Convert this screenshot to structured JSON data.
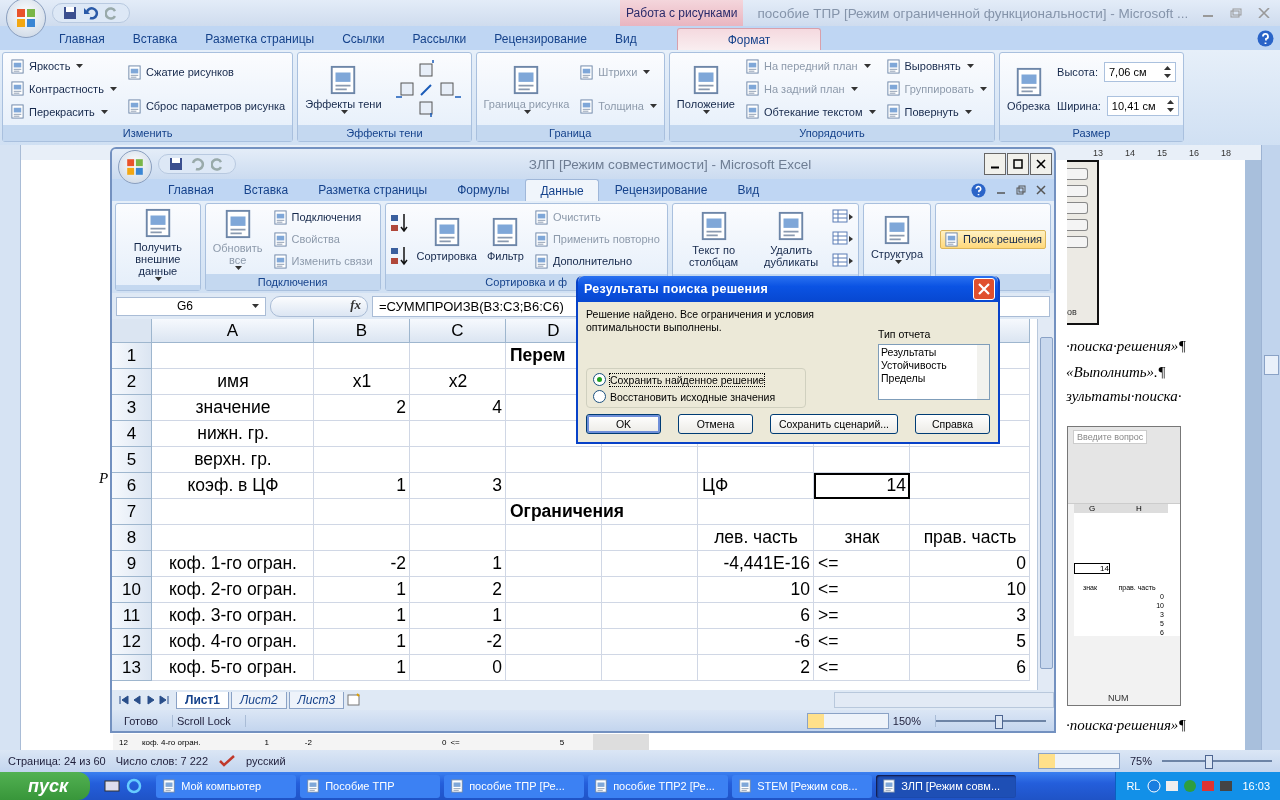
{
  "word": {
    "context_tab": "Работа с рисунками",
    "title": "пособие ТПР [Режим ограниченной функциональности] - Microsoft ...",
    "tabs": [
      {
        "label": "Главная",
        "selected": false
      },
      {
        "label": "Вставка",
        "selected": false
      },
      {
        "label": "Разметка страницы",
        "selected": false
      },
      {
        "label": "Ссылки",
        "selected": false
      },
      {
        "label": "Рассылки",
        "selected": false
      },
      {
        "label": "Рецензирование",
        "selected": false
      },
      {
        "label": "Вид",
        "selected": false
      },
      {
        "label": "Формат",
        "selected": true
      }
    ],
    "ribbon": [
      {
        "label": "Изменить",
        "columns": [
          [
            {
              "kind": "small",
              "label": "Яркость",
              "menu": true,
              "disabled": false
            },
            {
              "kind": "small",
              "label": "Контрастность",
              "menu": true,
              "disabled": false
            },
            {
              "kind": "small",
              "label": "Перекрасить",
              "menu": true,
              "disabled": false
            }
          ],
          [
            {
              "kind": "small",
              "label": "Сжатие рисунков",
              "menu": false,
              "disabled": false
            },
            {
              "kind": "small",
              "label": "Сброс параметров рисунка",
              "menu": false,
              "disabled": false
            }
          ]
        ]
      },
      {
        "label": "Эффекты тени",
        "columns": [
          [
            {
              "kind": "large",
              "label": "Эффекты тени",
              "menu": true,
              "disabled": false
            }
          ],
          [
            {
              "kind": "nudge"
            }
          ]
        ]
      },
      {
        "label": "Граница",
        "columns": [
          [
            {
              "kind": "large",
              "label": "Граница рисунка",
              "menu": true,
              "disabled": true
            }
          ],
          [
            {
              "kind": "small",
              "label": "Штрихи",
              "menu": true,
              "disabled": true
            },
            {
              "kind": "small",
              "label": "Толщина",
              "menu": true,
              "disabled": true
            }
          ]
        ]
      },
      {
        "label": "Упорядочить",
        "columns": [
          [
            {
              "kind": "large",
              "label": "Положение",
              "menu": true,
              "disabled": false
            }
          ],
          [
            {
              "kind": "small",
              "label": "На передний план",
              "menu": true,
              "disabled": true
            },
            {
              "kind": "small",
              "label": "На задний план",
              "menu": true,
              "disabled": true
            },
            {
              "kind": "small",
              "label": "Обтекание текстом",
              "menu": true,
              "disabled": false
            }
          ],
          [
            {
              "kind": "small",
              "label": "Выровнять",
              "menu": true,
              "disabled": false
            },
            {
              "kind": "small",
              "label": "Группировать",
              "menu": true,
              "disabled": true
            },
            {
              "kind": "small",
              "label": "Повернуть",
              "menu": true,
              "disabled": false
            }
          ]
        ]
      },
      {
        "label": "Размер",
        "columns": [
          [
            {
              "kind": "large",
              "label": "Обрезка",
              "menu": false,
              "disabled": false
            }
          ],
          [
            {
              "kind": "field",
              "label": "Высота:",
              "value": "7,06 см"
            },
            {
              "kind": "field",
              "label": "Ширина:",
              "value": "10,41 см"
            }
          ]
        ]
      }
    ],
    "ruler": [
      "13",
      "14",
      "15",
      "16",
      "18"
    ],
    "document": {
      "fragments": [
        {
          "text": "·поиска·решения»¶",
          "kind": "italic"
        },
        {
          "text": "«Выполнить».¶",
          "kind": "italic"
        },
        {
          "text": "зультаты·поиска·",
          "kind": "italic"
        },
        {
          "text": "·поиска·решения»¶",
          "kind": "italic"
        },
        {
          "text": "Р",
          "kind": "italic"
        }
      ],
      "top_image_text": "ов",
      "image_row": [
        "12",
        "коф. 4-го огран.",
        "1",
        "-2",
        "0",
        "<=",
        "5"
      ],
      "screenshot": {
        "question": "Введите вопрос",
        "columns": [
          "G",
          "H"
        ],
        "value": "14",
        "headers": [
          "знак",
          "прав. часть"
        ],
        "values": [
          "0",
          "10",
          "3",
          "5",
          "6"
        ],
        "status": "NUM"
      }
    },
    "status_bar": {
      "page": "Страница: 24 из 60",
      "words": "Число слов: 7 222",
      "language": "русский",
      "zoom": "75%",
      "level": 0.42
    }
  },
  "excel": {
    "title": "ЗЛП  [Режим совместимости] - Microsoft Excel",
    "tabs": [
      {
        "label": "Главная",
        "selected": false
      },
      {
        "label": "Вставка",
        "selected": false
      },
      {
        "label": "Разметка страницы",
        "selected": false
      },
      {
        "label": "Формулы",
        "selected": false
      },
      {
        "label": "Данные",
        "selected": true
      },
      {
        "label": "Рецензирование",
        "selected": false
      },
      {
        "label": "Вид",
        "selected": false
      }
    ],
    "ribbon": [
      {
        "columns": [
          [
            {
              "kind": "large",
              "label": "Получить внешние данные",
              "menu": true,
              "disabled": false
            }
          ]
        ]
      },
      {
        "label": "Подключения",
        "columns": [
          [
            {
              "kind": "large",
              "label": "Обновить все",
              "menu": true,
              "disabled": true
            }
          ],
          [
            {
              "kind": "small",
              "label": "Подключения",
              "menu": false,
              "disabled": false
            },
            {
              "kind": "small",
              "label": "Свойства",
              "menu": false,
              "disabled": true
            },
            {
              "kind": "small",
              "label": "Изменить связи",
              "menu": false,
              "disabled": true
            }
          ]
        ]
      },
      {
        "label": "Сортировка и ф",
        "columns": [
          [
            {
              "kind": "sort"
            },
            {
              "kind": "sort"
            }
          ],
          [
            {
              "kind": "large",
              "label": "Сортировка",
              "menu": false,
              "disabled": false
            }
          ],
          [
            {
              "kind": "large",
              "label": "Фильтр",
              "menu": false,
              "disabled": false
            }
          ],
          [
            {
              "kind": "small",
              "label": "Очистить",
              "menu": false,
              "disabled": true
            },
            {
              "kind": "small",
              "label": "Применить повторно",
              "menu": false,
              "disabled": true
            },
            {
              "kind": "small",
              "label": "Дополнительно",
              "menu": false,
              "disabled": false
            }
          ]
        ]
      },
      {
        "columns": [
          [
            {
              "kind": "large",
              "label": "Текст по столбцам",
              "menu": false,
              "disabled": false
            }
          ],
          [
            {
              "kind": "large",
              "label": "Удалить дубликаты",
              "menu": false,
              "disabled": false
            }
          ],
          [
            {
              "kind": "tool"
            },
            {
              "kind": "tool"
            },
            {
              "kind": "tool"
            }
          ]
        ]
      },
      {
        "columns": [
          [
            {
              "kind": "large",
              "label": "Структура",
              "menu": true,
              "disabled": false
            }
          ]
        ]
      },
      {
        "columns": [
          [
            {
              "kind": "small",
              "label": "Поиск решения",
              "menu": false,
              "disabled": false,
              "highlighted": true
            }
          ]
        ]
      }
    ],
    "name_box": "G6",
    "function_button": "fx",
    "formula": "=СУММПРОИЗВ(B3:C3;B6:C6)",
    "columns": [
      "A",
      "B",
      "C",
      "D"
    ],
    "rows": [
      {
        "number": "1",
        "kind": "section",
        "cells": {
          "d": {
            "text": "Перем",
            "selected": false
          }
        }
      },
      {
        "number": "2",
        "kind": "header",
        "cells": {
          "a": {
            "text": "имя",
            "selected": false
          },
          "b": {
            "text": "x1",
            "selected": false
          },
          "c": {
            "text": "x2",
            "selected": false
          }
        }
      },
      {
        "number": "3",
        "kind": "data",
        "cells": {
          "a": {
            "text": "значение",
            "selected": false
          },
          "b": {
            "text": "2",
            "selected": false
          },
          "c": {
            "text": "4",
            "selected": false
          }
        }
      },
      {
        "number": "4",
        "kind": "data",
        "cells": {
          "a": {
            "text": "нижн. гр.",
            "selected": false
          }
        }
      },
      {
        "number": "5",
        "kind": "data",
        "cells": {
          "a": {
            "text": "верхн. гр.",
            "selected": false
          }
        }
      },
      {
        "number": "6",
        "kind": "data",
        "cells": {
          "a": {
            "text": "коэф. в ЦФ",
            "selected": false
          },
          "b": {
            "text": "1",
            "selected": false
          },
          "c": {
            "text": "3",
            "selected": false
          },
          "f": {
            "text": "ЦФ",
            "selected": false
          },
          "g": {
            "text": "14",
            "selected": true
          }
        }
      },
      {
        "number": "7",
        "kind": "section",
        "cells": {
          "d": {
            "text": "Ограничения",
            "selected": false
          }
        }
      },
      {
        "number": "8",
        "kind": "header",
        "cells": {
          "f": {
            "text": "лев. часть",
            "selected": false
          },
          "g": {
            "text": "знак",
            "selected": false
          },
          "h": {
            "text": "прав. часть",
            "selected": false
          }
        }
      },
      {
        "number": "9",
        "kind": "data",
        "cells": {
          "a": {
            "text": "коф. 1-го огран.",
            "selected": false
          },
          "b": {
            "text": "-2",
            "selected": false
          },
          "c": {
            "text": "1",
            "selected": false
          },
          "f": {
            "text": "-4,441E-16",
            "selected": false
          },
          "g": {
            "text": "<=",
            "selected": false
          },
          "h": {
            "text": "0",
            "selected": false
          }
        }
      },
      {
        "number": "10",
        "kind": "data",
        "cells": {
          "a": {
            "text": "коф. 2-го огран.",
            "selected": false
          },
          "b": {
            "text": "1",
            "selected": false
          },
          "c": {
            "text": "2",
            "selected": false
          },
          "f": {
            "text": "10",
            "selected": false
          },
          "g": {
            "text": "<=",
            "selected": false
          },
          "h": {
            "text": "10",
            "selected": false
          }
        }
      },
      {
        "number": "11",
        "kind": "data",
        "cells": {
          "a": {
            "text": "коф. 3-го огран.",
            "selected": false
          },
          "b": {
            "text": "1",
            "selected": false
          },
          "c": {
            "text": "1",
            "selected": false
          },
          "f": {
            "text": "6",
            "selected": false
          },
          "g": {
            "text": ">=",
            "selected": false
          },
          "h": {
            "text": "3",
            "selected": false
          }
        }
      },
      {
        "number": "12",
        "kind": "data",
        "cells": {
          "a": {
            "text": "коф. 4-го огран.",
            "selected": false
          },
          "b": {
            "text": "1",
            "selected": false
          },
          "c": {
            "text": "-2",
            "selected": false
          },
          "f": {
            "text": "-6",
            "selected": false
          },
          "g": {
            "text": "<=",
            "selected": false
          },
          "h": {
            "text": "5",
            "selected": false
          }
        }
      },
      {
        "number": "13",
        "kind": "data",
        "cells": {
          "a": {
            "text": "коф. 5-го огран.",
            "selected": false
          },
          "b": {
            "text": "1",
            "selected": false
          },
          "c": {
            "text": "0",
            "selected": false
          },
          "f": {
            "text": "2",
            "selected": false
          },
          "g": {
            "text": "<=",
            "selected": false
          },
          "h": {
            "text": "6",
            "selected": false
          }
        }
      }
    ],
    "sheets": [
      {
        "label": "Лист1",
        "selected": true
      },
      {
        "label": "Лист2",
        "selected": false
      },
      {
        "label": "Лист3",
        "selected": false
      }
    ],
    "status_bar": {
      "ready": "Готово",
      "scroll_lock": "Scroll Lock",
      "zoom": "150%",
      "level": 0.56
    }
  },
  "dialog": {
    "title": "Результаты поиска решения",
    "message": "Решение найдено. Все ограничения и условия оптимальности выполнены.",
    "report_label": "Тип отчета",
    "report_types": [
      "Результаты",
      "Устойчивость",
      "Пределы"
    ],
    "options": [
      {
        "label": "Сохранить найденное решение",
        "selected": true
      },
      {
        "label": "Восстановить исходные значения",
        "selected": false
      }
    ],
    "buttons": [
      {
        "label": "OK",
        "default": true
      },
      {
        "label": "Отмена",
        "default": false
      },
      {
        "label": "Сохранить сценарий...",
        "default": false
      },
      {
        "label": "Справка",
        "default": false
      }
    ]
  },
  "taskbar": {
    "start": "пуск",
    "items": [
      {
        "label": "Мой компьютер",
        "selected": false
      },
      {
        "label": "Пособие ТПР",
        "selected": false
      },
      {
        "label": "пособие ТПР [Ре...",
        "selected": false
      },
      {
        "label": "пособие ТПР2 [Ре...",
        "selected": false
      },
      {
        "label": "STEM  [Режим сов...",
        "selected": false
      },
      {
        "label": "ЗЛП  [Режим совм...",
        "selected": true
      }
    ],
    "language": "RL",
    "clock": "16:03"
  }
}
